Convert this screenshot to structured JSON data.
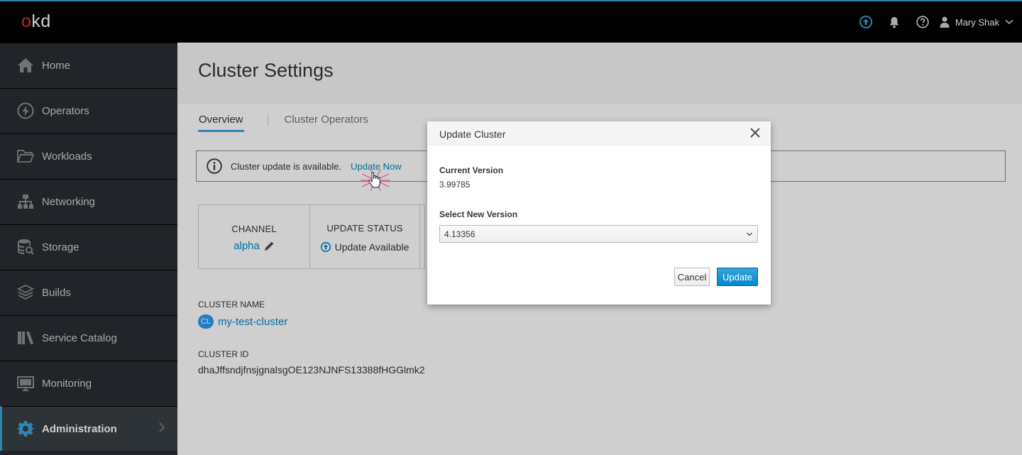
{
  "masthead": {
    "logo_o": "o",
    "logo_rest": "kd",
    "user_name": "Mary Shak",
    "icons": [
      "update-available-icon",
      "bell-icon",
      "help-icon",
      "user-icon",
      "chevron-down-icon"
    ],
    "accent": "#39a5dc"
  },
  "sidebar": {
    "items": [
      {
        "label": "Home",
        "icon": "home-icon"
      },
      {
        "label": "Operators",
        "icon": "bolt-icon"
      },
      {
        "label": "Workloads",
        "icon": "folder-icon"
      },
      {
        "label": "Networking",
        "icon": "network-icon"
      },
      {
        "label": "Storage",
        "icon": "database-icon"
      },
      {
        "label": "Builds",
        "icon": "layers-icon"
      },
      {
        "label": "Service Catalog",
        "icon": "catalog-icon"
      },
      {
        "label": "Monitoring",
        "icon": "monitor-icon"
      },
      {
        "label": "Administration",
        "icon": "gear-icon",
        "active": true
      }
    ]
  },
  "page": {
    "title": "Cluster Settings",
    "tabs": [
      {
        "label": "Overview",
        "active": true
      },
      {
        "label": "Cluster Operators",
        "active": false
      }
    ],
    "alert": {
      "message": "Cluster update is available.",
      "link": "Update Now"
    },
    "details": {
      "channel_label": "CHANNEL",
      "channel_value": "alpha",
      "update_status_label": "UPDATE STATUS",
      "update_status_value": "Update Available"
    },
    "cluster_name_label": "CLUSTER NAME",
    "cluster_badge": "CL",
    "cluster_name": "my-test-cluster",
    "cluster_id_label": "CLUSTER ID",
    "cluster_id": "dhaJffsndjfnsjgnalsgOE123NJNFS13388fHGGlmk2"
  },
  "modal": {
    "title": "Update Cluster",
    "current_version_label": "Current Version",
    "current_version": "3.99785",
    "new_version_label": "Select New Version",
    "new_version_selected": "4.13356",
    "cancel_label": "Cancel",
    "update_label": "Update"
  },
  "colors": {
    "link": "#0088ce",
    "primary_button": "#0088ce",
    "sidebar_bg": "#292e34",
    "logo_o": "#e12d32",
    "cursor_highlight": "#e91e8c"
  }
}
